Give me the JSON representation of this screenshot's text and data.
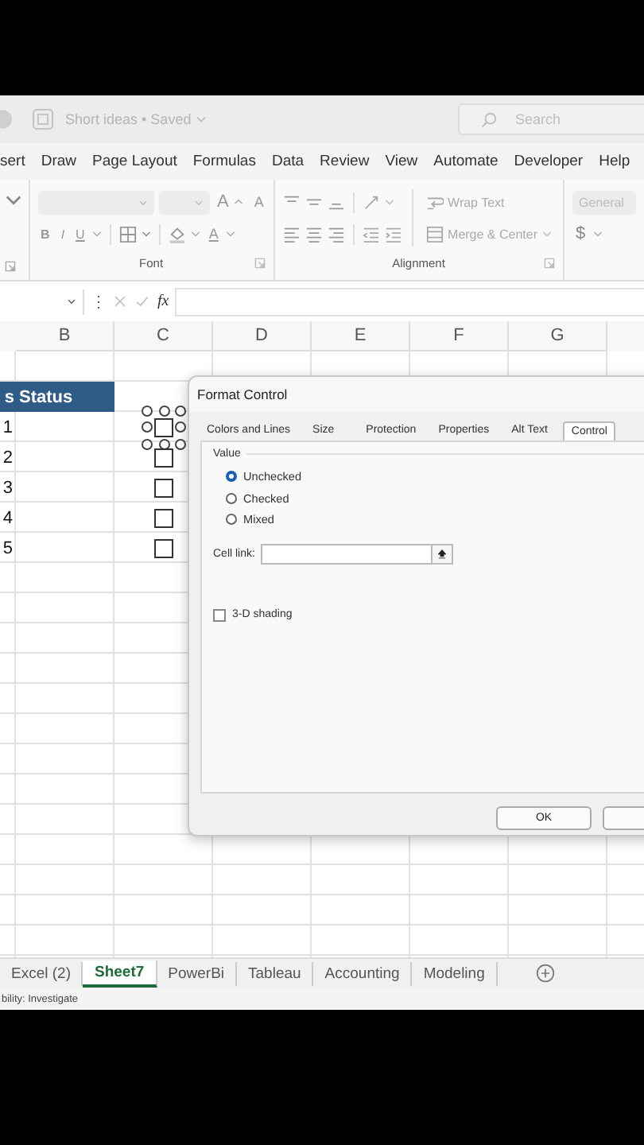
{
  "title_bar": {
    "document": "Short ideas • Saved",
    "search": {
      "placeholder": "Search"
    }
  },
  "ribbon_tabs": [
    "sert",
    "Draw",
    "Page Layout",
    "Formulas",
    "Data",
    "Review",
    "View",
    "Automate",
    "Developer",
    "Help"
  ],
  "ribbon": {
    "grow_font": "A",
    "shrink_font": "A",
    "bold": "B",
    "italic": "I",
    "underline": "U",
    "font_color": "A",
    "font_label": "Font",
    "wrap_text": "Wrap Text",
    "merge_center": "Merge & Center",
    "alignment_label": "Alignment",
    "number_format": "General",
    "currency": "$"
  },
  "formula_bar": {
    "more": "⋮",
    "fx": "fx"
  },
  "columns": [
    "B",
    "C",
    "D",
    "E",
    "F",
    "G"
  ],
  "table": {
    "header": [
      "s",
      "Status"
    ],
    "rows": [
      {
        "value": "1",
        "checked": false,
        "selected": true
      },
      {
        "value": "2",
        "checked": false,
        "selected": false
      },
      {
        "value": "3",
        "checked": false,
        "selected": false
      },
      {
        "value": "4",
        "checked": false,
        "selected": false
      },
      {
        "value": "5",
        "checked": false,
        "selected": false
      }
    ]
  },
  "dialog": {
    "title": "Format Control",
    "tabs": [
      {
        "label": "Colors and Lines",
        "selected": false
      },
      {
        "label": "Size",
        "selected": false
      },
      {
        "label": "Protection",
        "selected": false
      },
      {
        "label": "Properties",
        "selected": false
      },
      {
        "label": "Alt Text",
        "selected": false
      },
      {
        "label": "Control",
        "selected": true
      }
    ],
    "value_label": "Value",
    "options": [
      {
        "label": "Unchecked",
        "selected": true
      },
      {
        "label": "Checked",
        "selected": false
      },
      {
        "label": "Mixed",
        "selected": false
      }
    ],
    "cell_link": {
      "label": "Cell link:"
    },
    "shading": {
      "label": "3-D shading",
      "checked": false
    },
    "buttons": [
      "OK"
    ]
  },
  "sheet_tabs": [
    {
      "label": "Excel (2)",
      "selected": false
    },
    {
      "label": "Sheet7",
      "selected": true
    },
    {
      "label": "PowerBi",
      "selected": false
    },
    {
      "label": "Tableau",
      "selected": false
    },
    {
      "label": "Accounting",
      "selected": false
    },
    {
      "label": "Modeling",
      "selected": false
    }
  ],
  "status_bar": "bility: Investigate"
}
